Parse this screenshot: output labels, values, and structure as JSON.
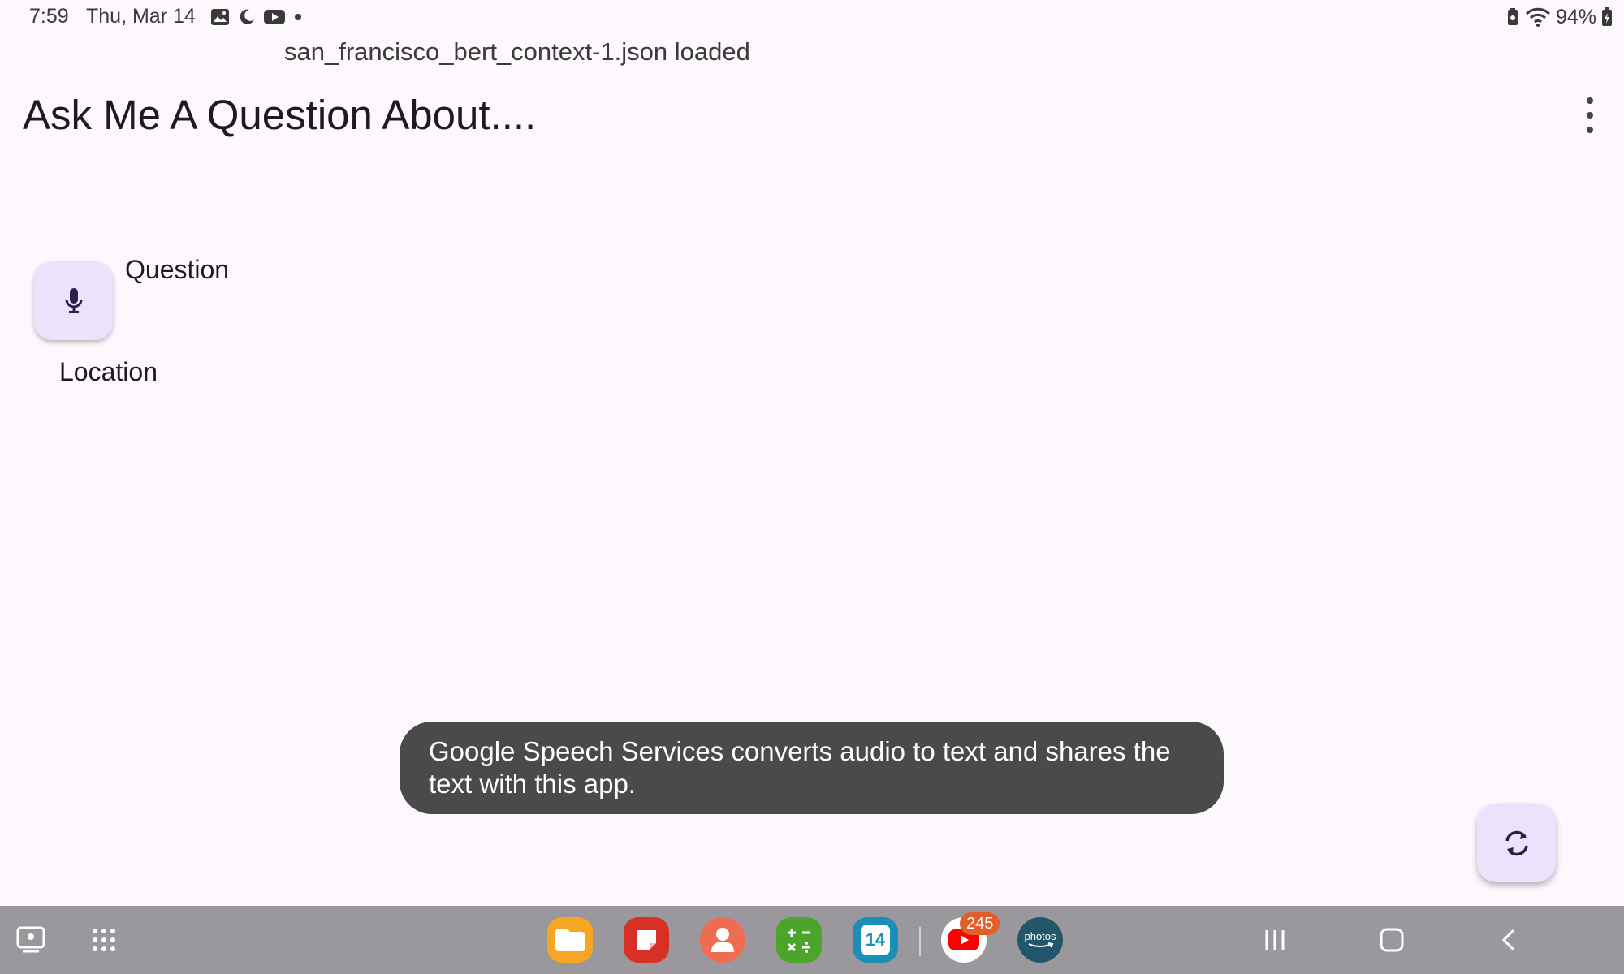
{
  "status_bar": {
    "time": "7:59",
    "date": "Thu, Mar 14",
    "battery": "94%",
    "icons": [
      "gallery-icon",
      "moon-icon",
      "youtube-icon",
      "dot-icon",
      "battery-saver-icon",
      "wifi-icon",
      "battery-icon"
    ]
  },
  "top_message": "san_francisco_bert_context-1.json loaded",
  "app_bar": {
    "title": "Ask Me A Question About....",
    "menu_icon": "more-vert-icon"
  },
  "question_label": "Question",
  "location_label": "Location",
  "mic_icon": "mic-icon",
  "toast": "Google Speech Services converts audio to text and shares the text with this app.",
  "refresh_icon": "refresh-icon",
  "taskbar": {
    "apps": [
      "files-app",
      "notes-app",
      "contacts-app",
      "calculator-app",
      "calendar-app",
      "youtube-app",
      "amazon-photos-app"
    ],
    "calendar_day": "14",
    "youtube_badge": "245",
    "photos_label": "photos"
  },
  "colors": {
    "background": "#fdf7fe",
    "fab": "#ebe2fb",
    "toast": "#4a4a4a",
    "taskbar": "#9a989d"
  }
}
